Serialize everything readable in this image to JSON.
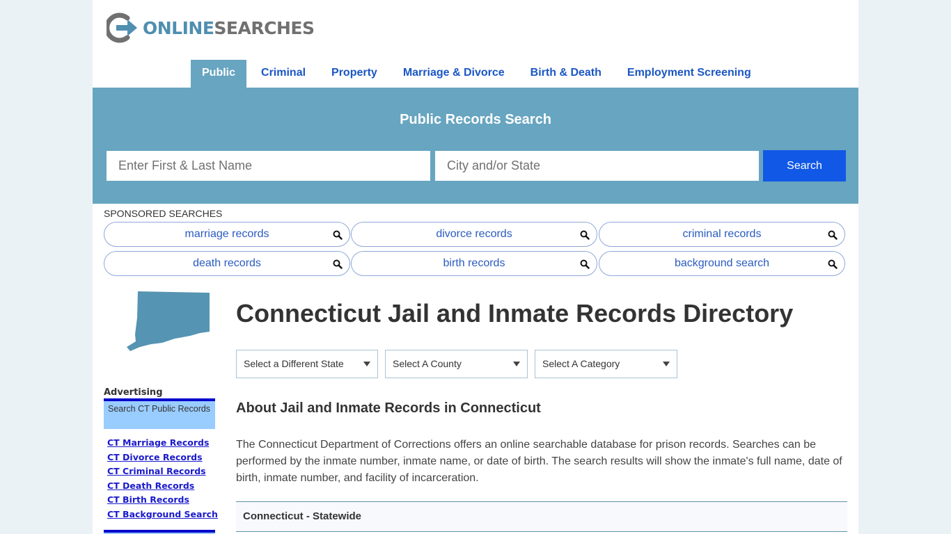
{
  "brand": {
    "logo_icon": "power-arrow-logo-icon",
    "name_part1": "ONLINE",
    "name_part2": "SEARCHES",
    "primary_color": "#4f8fb0",
    "secondary_color": "#707070"
  },
  "nav": {
    "items": [
      {
        "label": "Public",
        "active": true
      },
      {
        "label": "Criminal",
        "active": false
      },
      {
        "label": "Property",
        "active": false
      },
      {
        "label": "Marriage & Divorce",
        "active": false
      },
      {
        "label": "Birth & Death",
        "active": false
      },
      {
        "label": "Employment Screening",
        "active": false
      }
    ]
  },
  "hero": {
    "title": "Public Records Search",
    "name_placeholder": "Enter First & Last Name",
    "name_value": "",
    "city_placeholder": "City and/or State",
    "city_value": "",
    "search_label": "Search",
    "background_color": "#67a5c0",
    "button_color": "#1158e6"
  },
  "sponsored": {
    "label": "SPONSORED SEARCHES",
    "icon": "search-icon",
    "items": [
      {
        "label": "marriage records"
      },
      {
        "label": "divorce records"
      },
      {
        "label": "criminal records"
      },
      {
        "label": "death records"
      },
      {
        "label": "birth records"
      },
      {
        "label": "background search"
      }
    ]
  },
  "sidebar": {
    "state_map_icon": "connecticut-state-map-icon",
    "advertising_label": "Advertising",
    "ad_box_title": "Search CT Public Records",
    "links": [
      {
        "label": "CT Marriage Records"
      },
      {
        "label": "CT Divorce Records"
      },
      {
        "label": "CT Criminal Records"
      },
      {
        "label": "CT Death Records"
      },
      {
        "label": "CT Birth Records"
      },
      {
        "label": "CT Background Search"
      }
    ]
  },
  "main": {
    "title": "Connecticut Jail and Inmate Records Directory",
    "selects": {
      "state": "Select a Different State",
      "county": "Select A County",
      "category": "Select A Category"
    },
    "section_title": "About Jail and Inmate Records in Connecticut",
    "body": "The Connecticut Department of Corrections offers an online searchable database for prison records. Searches can be performed by the inmate number, inmate name, or date of birth. The search results will show the inmate's full name, date of birth, inmate number, and facility of incarceration.",
    "statewide_header": "Connecticut - Statewide"
  }
}
